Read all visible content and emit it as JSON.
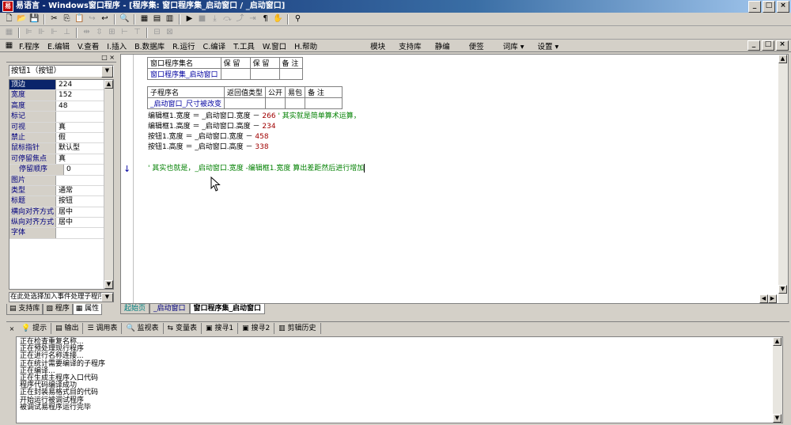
{
  "window": {
    "title": "易语言 - Windows窗口程序 - [程序集: 窗口程序集_启动窗口 / _启动窗口]",
    "app_icon": "易",
    "buttons": [
      "_",
      "□",
      "×"
    ],
    "inner_buttons": [
      "_",
      "□",
      "×"
    ]
  },
  "menu": [
    {
      "key": "F",
      "label": "F.程序"
    },
    {
      "key": "E",
      "label": "E.编辑"
    },
    {
      "key": "V",
      "label": "V.查看"
    },
    {
      "key": "I",
      "label": "I.插入"
    },
    {
      "key": "B",
      "label": "B.数据库"
    },
    {
      "key": "R",
      "label": "R.运行"
    },
    {
      "key": "C",
      "label": "C.编译"
    },
    {
      "key": "T",
      "label": "T.工具"
    },
    {
      "key": "W",
      "label": "W.窗口"
    },
    {
      "key": "H",
      "label": "H.帮助"
    }
  ],
  "menu_extra": [
    "模块",
    "支持库",
    "静编",
    "便签",
    "词库 ▾",
    "设置 ▾"
  ],
  "left_panel": {
    "title_buttons": [
      "□",
      "×"
    ],
    "object_combo": "按钮1（按钮）",
    "properties": [
      {
        "name": "顶边",
        "value": "224",
        "selected": true
      },
      {
        "name": "宽度",
        "value": "152"
      },
      {
        "name": "高度",
        "value": "48"
      },
      {
        "name": "标记",
        "value": ""
      },
      {
        "name": "可视",
        "value": "真"
      },
      {
        "name": "禁止",
        "value": "假"
      },
      {
        "name": "鼠标指针",
        "value": "默认型"
      },
      {
        "name": "可停留焦点",
        "value": "真"
      },
      {
        "name": "停留顺序",
        "value": "0",
        "indent": true
      },
      {
        "name": "图片",
        "value": ""
      },
      {
        "name": "类型",
        "value": "通常"
      },
      {
        "name": "标题",
        "value": "按钮"
      },
      {
        "name": "横向对齐方式",
        "value": "居中"
      },
      {
        "name": "纵向对齐方式",
        "value": "居中"
      },
      {
        "name": "字体",
        "value": ""
      }
    ],
    "event_combo": "在此处选择加入事件处理子程序",
    "tabs": [
      "支持库",
      "程序",
      "属性"
    ]
  },
  "editor": {
    "assembly_table": {
      "headers": [
        "窗口程序集名",
        "保 留",
        "保 留",
        "备 注"
      ],
      "row": [
        "窗口程序集_启动窗口",
        "",
        "",
        ""
      ]
    },
    "sub_table": {
      "headers": [
        "子程序名",
        "返回值类型",
        "公开",
        "易包",
        "备 注"
      ],
      "row": [
        "_启动窗口_尺寸被改变",
        "",
        "",
        "",
        ""
      ]
    },
    "lines": [
      {
        "code": "编辑框1.宽度 ＝ _启动窗口.宽度 － ",
        "num": "266",
        "comment": "  ' 其实就是简单算术运算，"
      },
      {
        "code": "编辑框1.高度 ＝ _启动窗口.高度 － ",
        "num": "234",
        "comment": ""
      },
      {
        "code": "按钮1.宽度 ＝ _启动窗口.宽度 － ",
        "num": "458",
        "comment": ""
      },
      {
        "code": "按钮1.高度 ＝ _启动窗口.高度 － ",
        "num": "338",
        "comment": ""
      }
    ],
    "comment_line": "' 其实也就是，_启动窗口.宽度 -编辑框1.宽度 算出差距然后进行增加",
    "gutter_arrow": "↓",
    "tabs": [
      "起始页",
      "_启动窗口",
      "窗口程序集_启动窗口"
    ]
  },
  "bottom": {
    "tabs": [
      "提示",
      "输出",
      "调用表",
      "监视表",
      "变量表",
      "搜寻1",
      "搜寻2",
      "剪辑历史"
    ],
    "output_lines": [
      "正在检查重复名称...",
      "正在预处理现行程序",
      "正在进行名称连接...",
      "正在统计需要编译的子程序",
      "正在编译...",
      "正在生成主程序入口代码",
      "程序代码编译成功",
      "正在封装易格式目的代码",
      "开始运行被调试程序",
      "被调试易程序运行完毕"
    ]
  }
}
